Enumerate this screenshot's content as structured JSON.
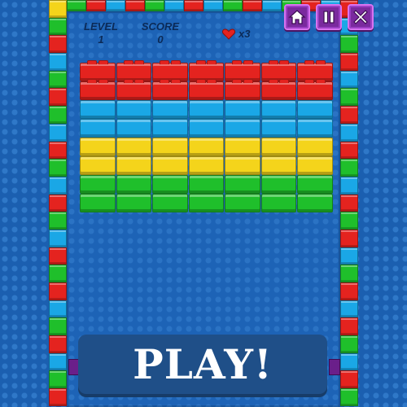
{
  "hud": {
    "level_label": "LEVEL",
    "level_value": "1",
    "score_label": "SCORE",
    "score_value": "0",
    "lives_text": "x3"
  },
  "buttons": [
    {
      "name": "home",
      "icon": "home-icon"
    },
    {
      "name": "pause",
      "icon": "pause-icon"
    },
    {
      "name": "close",
      "icon": "close-icon"
    }
  ],
  "bricks": {
    "columns": 7,
    "rows": [
      "red",
      "red",
      "blue",
      "blue",
      "yellow",
      "yellow",
      "green",
      "green"
    ]
  },
  "colors": {
    "red": "#e4231f",
    "blue": "#1aa7e6",
    "yellow": "#f4d41b",
    "green": "#1fbf2b",
    "button_purple": "#7a2a9e"
  },
  "play_button": {
    "label": "PLAY!"
  },
  "border_pattern": {
    "left": [
      "yellow",
      "green",
      "red",
      "blue",
      "green",
      "red",
      "green",
      "blue",
      "red",
      "green",
      "blue",
      "red",
      "green",
      "blue",
      "red",
      "green",
      "red",
      "blue",
      "green",
      "red",
      "blue",
      "green",
      "red"
    ],
    "right": [
      "red",
      "blue",
      "green",
      "red",
      "blue",
      "green",
      "red",
      "blue",
      "red",
      "green",
      "blue",
      "red",
      "green",
      "red",
      "blue",
      "green",
      "red",
      "blue",
      "red",
      "green",
      "blue",
      "red",
      "green"
    ],
    "top": [
      "green",
      "red",
      "blue",
      "red",
      "green",
      "blue",
      "red",
      "blue",
      "green",
      "red",
      "blue",
      "green",
      "red",
      "blue"
    ]
  }
}
